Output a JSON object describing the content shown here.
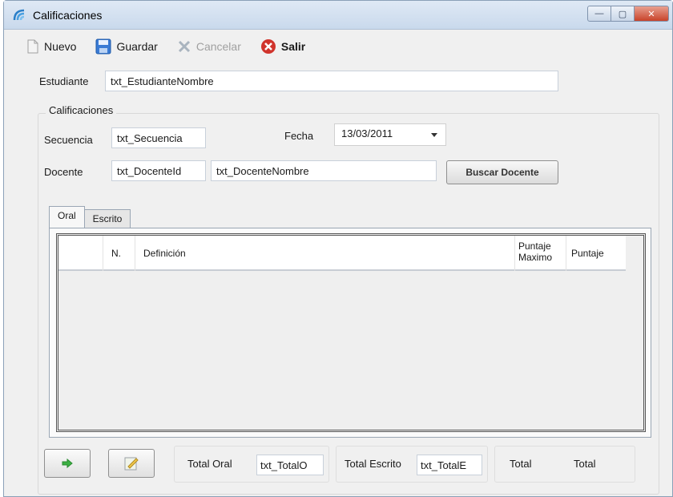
{
  "window": {
    "title": "Calificaciones",
    "controls": {
      "minimize": "—",
      "maximize": "▢",
      "close": "✕"
    }
  },
  "toolbar": {
    "new_label": "Nuevo",
    "save_label": "Guardar",
    "cancel_label": "Cancelar",
    "exit_label": "Salir"
  },
  "form": {
    "student_label": "Estudiante",
    "student_value": "txt_EstudianteNombre",
    "group_label": "Calificaciones",
    "sequence_label": "Secuencia",
    "sequence_value": "txt_Secuencia",
    "date_label": "Fecha",
    "date_value": "13/03/2011",
    "teacher_label": "Docente",
    "teacher_id_value": "txt_DocenteId",
    "teacher_name_value": "txt_DocenteNombre",
    "search_teacher_label": "Buscar Docente"
  },
  "tabs": [
    {
      "label": "Oral",
      "active": true
    },
    {
      "label": "Escrito",
      "active": false
    }
  ],
  "grid": {
    "columns": [
      "N.",
      "Definición",
      "Puntaje Maximo",
      "Puntaje"
    ]
  },
  "totals": {
    "oral_label": "Total Oral",
    "oral_value": "txt_TotalO",
    "written_label": "Total Escrito",
    "written_value": "txt_TotalE",
    "total_label": "Total",
    "total_value": "Total"
  },
  "colors": {
    "window_bg": "#f0f0f0",
    "titlebar": "#c9d9ec",
    "cancel_icon": "#a9b4bf",
    "exit_icon": "#d0342c",
    "save_icon": "#3a7bd5"
  }
}
